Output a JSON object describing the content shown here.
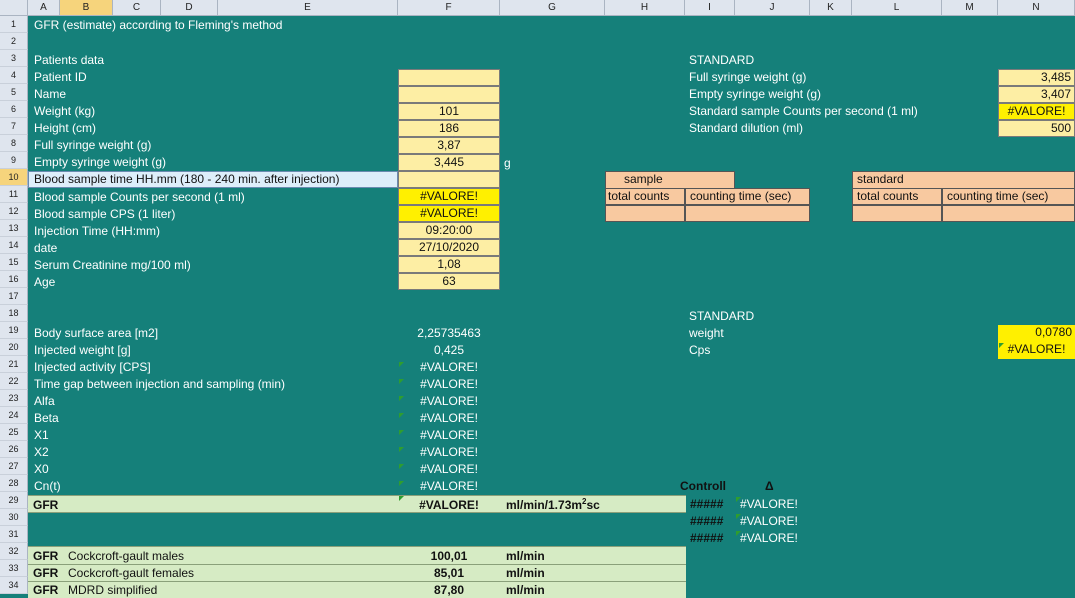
{
  "columns": [
    "A",
    "B",
    "C",
    "D",
    "E",
    "F",
    "G",
    "H",
    "I",
    "J",
    "K",
    "L",
    "M",
    "N"
  ],
  "rows": [
    "1",
    "2",
    "3",
    "4",
    "5",
    "6",
    "7",
    "8",
    "9",
    "10",
    "11",
    "12",
    "13",
    "14",
    "15",
    "16",
    "17",
    "18",
    "19",
    "20",
    "21",
    "22",
    "23",
    "24",
    "25",
    "26",
    "27",
    "28",
    "29",
    "30",
    "31",
    "32",
    "33",
    "34"
  ],
  "title": "GFR (estimate) according to Fleming's method",
  "patients": {
    "heading": "Patients data",
    "labels": [
      "Patient ID",
      "Name",
      "Weight (kg)",
      "Height (cm)",
      "Full syringe weight (g)",
      "Empty syringe weight (g)"
    ],
    "values": [
      "",
      "",
      "101",
      "186",
      "3,87",
      "3,445"
    ],
    "empty_unit": "g"
  },
  "blood_time_label": "Blood sample time HH.mm (180 - 240 min. after injection)",
  "labels2": [
    "Blood sample Counts per second (1 ml)",
    "Blood sample CPS (1 liter)",
    "Injection Time (HH:mm)",
    "date",
    "Serum Creatinine mg/100 ml)",
    "Age"
  ],
  "values2": [
    "#VALORE!",
    "#VALORE!",
    "09:20:00",
    "27/10/2020",
    "1,08",
    "63"
  ],
  "standard_top": {
    "heading": "STANDARD",
    "labels": [
      "Full syringe weight (g)",
      "Empty syringe weight (g)",
      "Standard sample Counts per second (1 ml)",
      "Standard dilution (ml)"
    ],
    "values": [
      "3,485",
      "3,407",
      "#VALORE!",
      "500"
    ]
  },
  "sample_box": {
    "title": "sample",
    "col1": "total counts",
    "col2": "counting time (sec)"
  },
  "standard_box": {
    "title": "standard",
    "col1": "total counts",
    "col2": "counting time (sec)"
  },
  "results": {
    "labels": [
      "Body surface area [m2]",
      "Injected weight  [g]",
      "Injected activity [CPS]",
      "Time gap between injection and sampling  (min)",
      "Alfa",
      "Beta",
      "X1",
      "X2",
      "X0",
      "Cn(t)"
    ],
    "values": [
      "2,25735463",
      "0,425",
      "#VALORE!",
      "#VALORE!",
      "#VALORE!",
      "#VALORE!",
      "#VALORE!",
      "#VALORE!",
      "#VALORE!",
      "#VALORE!"
    ]
  },
  "standard_bottom": {
    "heading": "STANDARD",
    "labels": [
      "weight",
      "Cps"
    ],
    "values": [
      "0,0780",
      "#VALORE!"
    ]
  },
  "gfr": {
    "label": "GFR",
    "value": "#VALORE!",
    "unit": "ml/min/1.73m",
    "unit_sup": "2",
    "unit_suffix": "sc"
  },
  "controll": {
    "label": "Controll",
    "delta": "Δ",
    "rows": [
      [
        "#####",
        "#VALORE!"
      ],
      [
        "#####",
        "#VALORE!"
      ],
      [
        "#####",
        "#VALORE!"
      ]
    ]
  },
  "formulas": [
    {
      "tag": "GFR",
      "name": "Cockcroft-gault males",
      "value": "100,01",
      "unit": "ml/min"
    },
    {
      "tag": "GFR",
      "name": "Cockcroft-gault females",
      "value": "85,01",
      "unit": "ml/min"
    },
    {
      "tag": "GFR",
      "name": "MDRD simplified",
      "value": "87,80",
      "unit": "ml/min"
    }
  ]
}
